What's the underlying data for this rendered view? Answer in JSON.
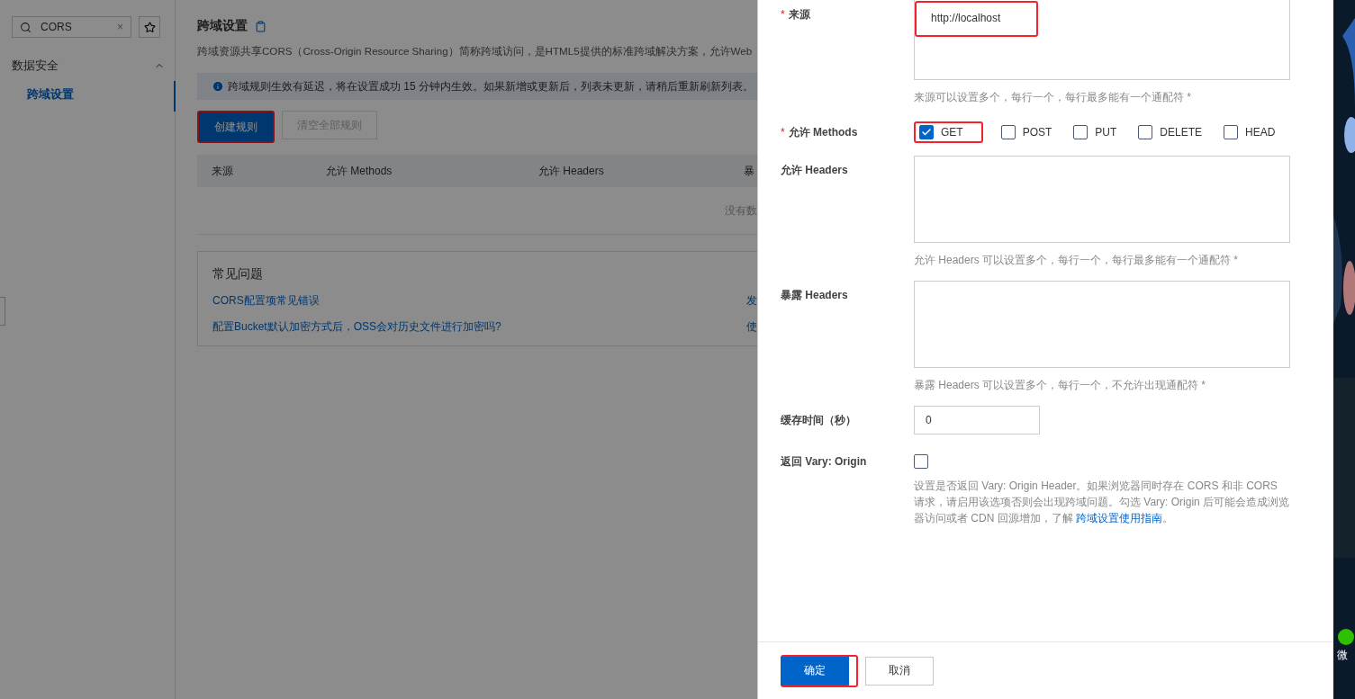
{
  "search": {
    "value": "CORS",
    "clear_glyph": "×"
  },
  "sidebar": {
    "groups": [
      {
        "label": "数据安全",
        "expanded": true,
        "children": [
          {
            "label": "跨域设置",
            "selected": true
          }
        ]
      }
    ]
  },
  "page": {
    "title": "跨域设置",
    "description": "跨域资源共享CORS（Cross-Origin Resource Sharing）简称跨域访问，是HTML5提供的标准跨域解决方案，允许Web",
    "notice": "跨域规则生效有延迟，将在设置成功 15 分钟内生效。如果新增或更新后，列表未更新，请稍后重新刷新列表。",
    "actions": [
      {
        "label": "创建规则",
        "kind": "primary",
        "disabled": false,
        "highlighted": true
      },
      {
        "label": "清空全部规则",
        "kind": "default",
        "disabled": true,
        "highlighted": false
      }
    ],
    "table": {
      "columns": [
        "来源",
        "允许 Methods",
        "允许 Headers",
        "暴"
      ],
      "empty_text": "没有数"
    },
    "faq": {
      "title": "常见问题",
      "links": [
        {
          "text": "CORS配置项常见错误",
          "column_2": "发"
        },
        {
          "text": "配置Bucket默认加密方式后，OSS会对历史文件进行加密吗?",
          "column_2": "使"
        }
      ]
    }
  },
  "drawer": {
    "fields": [
      {
        "kind": "textarea",
        "label": "来源",
        "required_mark": "*",
        "value": "http://localhost",
        "highlighted": true,
        "hint": "来源可以设置多个，每行一个，每行最多能有一个通配符 *"
      },
      {
        "kind": "checkboxes",
        "label": "允许 Methods",
        "required_mark": "*",
        "options": [
          {
            "label": "GET",
            "checked": true,
            "highlighted": true
          },
          {
            "label": "POST",
            "checked": false,
            "highlighted": false
          },
          {
            "label": "PUT",
            "checked": false,
            "highlighted": false
          },
          {
            "label": "DELETE",
            "checked": false,
            "highlighted": false
          },
          {
            "label": "HEAD",
            "checked": false,
            "highlighted": false
          }
        ]
      },
      {
        "kind": "textarea",
        "label": "允许 Headers",
        "hint": "允许 Headers 可以设置多个，每行一个，每行最多能有一个通配符 *"
      },
      {
        "kind": "textarea",
        "label": "暴露 Headers",
        "hint": "暴露 Headers 可以设置多个，每行一个，不允许出现通配符 *"
      },
      {
        "kind": "input",
        "label": "缓存时间（秒）",
        "value": "0"
      },
      {
        "kind": "checkbox",
        "label": "返回 Vary: Origin",
        "checked": false,
        "hint": "设置是否返回 Vary: Origin Header。如果浏览器同时存在 CORS 和非 CORS 请求，请启用该选项否则会出现跨域问题。勾选 Vary: Origin 后可能会造成浏览器访问或者 CDN 回源增加，了解 ",
        "link": "跨域设置使用指南",
        "hint_end": "。"
      }
    ],
    "buttons": [
      {
        "label": "确定",
        "kind": "primary",
        "highlighted": true
      },
      {
        "label": "取消",
        "kind": "default",
        "highlighted": false
      }
    ]
  },
  "desktop": {
    "icon_label": "微"
  }
}
